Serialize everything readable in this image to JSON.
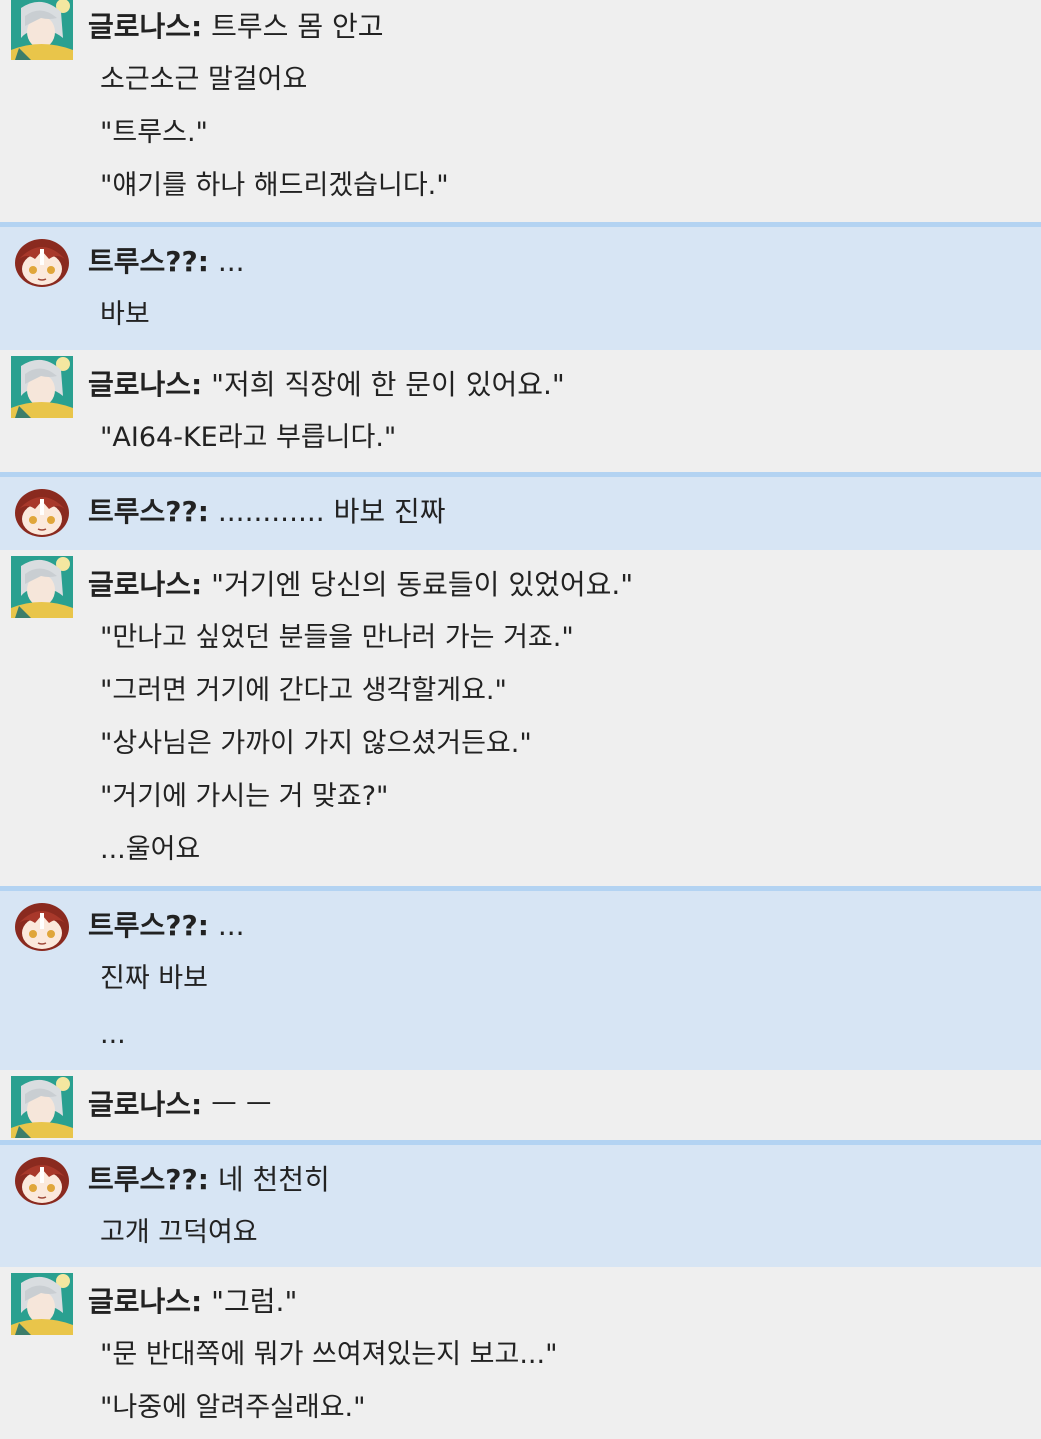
{
  "messages": [
    {
      "speaker": "글로나스",
      "first": "트루스 몸 안고",
      "lines": [
        "소근소근 말걸어요",
        "\"트루스.\"",
        "\"얘기를 하나 해드리겠습니다.\""
      ]
    },
    {
      "speaker": "트루스??",
      "first": "...",
      "lines": [
        "바보"
      ]
    },
    {
      "speaker": "글로나스",
      "first": "\"저희 직장에 한 문이 있어요.\"",
      "lines": [
        "\"AI64-KE라고 부릅니다.\""
      ]
    },
    {
      "speaker": "트루스??",
      "first": "............ 바보 진짜",
      "lines": []
    },
    {
      "speaker": "글로나스",
      "first": "\"거기엔 당신의 동료들이 있었어요.\"",
      "lines": [
        "\"만나고 싶었던 분들을 만나러 가는 거죠.\"",
        "\"그러면 거기에 간다고 생각할게요.\"",
        "\"상사님은 가까이 가지 않으셨거든요.\"",
        "\"거기에 가시는 거 맞죠?\"",
        "...울어요"
      ]
    },
    {
      "speaker": "트루스??",
      "first": "...",
      "lines": [
        "진짜 바보",
        "..."
      ]
    },
    {
      "speaker": "글로나스",
      "first": "ㅡ ㅡ",
      "lines": []
    },
    {
      "speaker": "트루스??",
      "first": "네 천천히",
      "lines": [
        "고개 끄덕여요"
      ]
    },
    {
      "speaker": "글로나스",
      "first": "\"그럼.\"",
      "lines": [
        "\"문 반대쪽에 뭐가 쓰여져있는지 보고...\"",
        "\"나중에 알려주실래요.\""
      ]
    }
  ],
  "colors": {
    "glonas_bg": "#efefef",
    "truth_bg": "#d7e5f4",
    "truth_border": "#b3d3f2"
  }
}
